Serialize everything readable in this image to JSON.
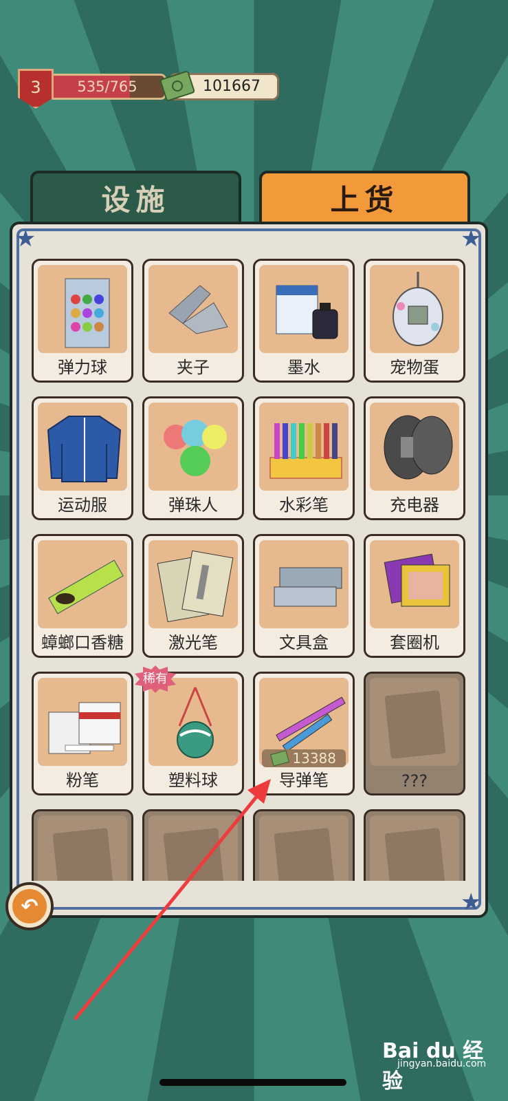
{
  "hud": {
    "level": "3",
    "xp_text": "535/765",
    "xp_progress": 0.699,
    "money": "101667"
  },
  "tabs": [
    {
      "label": "设施",
      "active": false
    },
    {
      "label": "上货",
      "active": true
    }
  ],
  "items": [
    {
      "label": "弹力球",
      "state": "unlocked"
    },
    {
      "label": "夹子",
      "state": "unlocked"
    },
    {
      "label": "墨水",
      "state": "unlocked"
    },
    {
      "label": "宠物蛋",
      "state": "unlocked"
    },
    {
      "label": "运动服",
      "state": "unlocked"
    },
    {
      "label": "弹珠人",
      "state": "unlocked"
    },
    {
      "label": "水彩笔",
      "state": "unlocked"
    },
    {
      "label": "充电器",
      "state": "unlocked"
    },
    {
      "label": "蟑螂口香糖",
      "state": "unlocked"
    },
    {
      "label": "激光笔",
      "state": "unlocked"
    },
    {
      "label": "文具盒",
      "state": "unlocked"
    },
    {
      "label": "套圈机",
      "state": "unlocked"
    },
    {
      "label": "粉笔",
      "state": "unlocked"
    },
    {
      "label": "塑料球",
      "state": "unlocked",
      "badge": "稀有"
    },
    {
      "label": "导弹笔",
      "state": "purchasable",
      "price": "13388"
    },
    {
      "label": "???",
      "state": "locked"
    }
  ],
  "icons": {
    "back": "back-arrow-icon",
    "money": "cash-icon"
  },
  "watermark": {
    "brand": "Bai du 经验",
    "domain": "jingyan.baidu.com"
  },
  "colors": {
    "active_tab": "#f29a3a",
    "inactive_tab": "#2b5a48",
    "xp_fill": "#c5404a",
    "annotation_arrow": "#ee3b3b"
  }
}
